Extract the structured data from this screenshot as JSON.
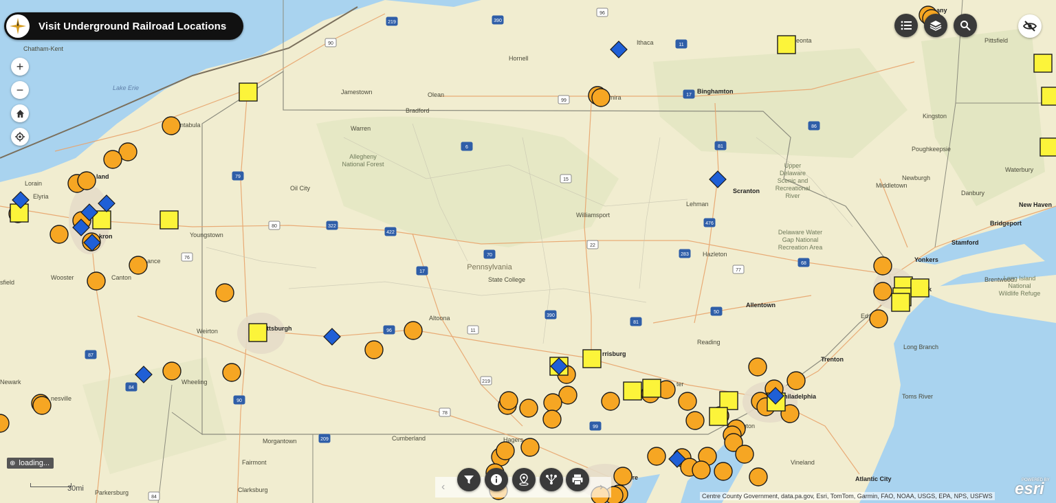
{
  "app": {
    "title": "Visit Underground Railroad Locations"
  },
  "colors": {
    "orange": "#f6a623",
    "yellow": "#fcf43a",
    "blue": "#1f5fd6",
    "dark": "#111111"
  },
  "labels": {
    "regions": [
      "Pennsylvania",
      "Allegheny",
      "National Forest",
      "Upper",
      "Delaware",
      "Scenic and",
      "Recreational",
      "River",
      "Delaware Water",
      "Gap National",
      "Recreation Area",
      "Long Island",
      "National",
      "Wildlife Refuge"
    ],
    "cities": [
      "Chatham-Kent",
      "Lorain",
      "Elyria",
      "land",
      "kron",
      "Canton",
      "Wooster",
      "sfield",
      "ntabula",
      "Youngstown",
      "ance",
      "Oil City",
      "Warren",
      "Bradford",
      "Jamestown",
      "Olean",
      "Hornell",
      "Ithaca",
      "mira",
      "Binghamton",
      "eonta",
      "Williamsport",
      "State College",
      "Altoona",
      "ttsburgh",
      "Weirton",
      "Wheeling",
      "nesville",
      "Newark",
      "Morgantown",
      "Fairmont",
      "Clarksburg",
      "Parkersburg",
      "Cumberland",
      "Hagers",
      "rrisburg",
      "Reading",
      "ter",
      "Allentown",
      "Scranton",
      "Lehman",
      "Hazleton",
      "hiladelphia",
      "Trenton",
      "Vineland",
      "Atlantic City",
      "Toms River",
      "Long Branch",
      "mington",
      "ltimore",
      "Yonkers",
      "Stamford",
      "Bridgeport",
      "New Haven",
      "Waterbury",
      "Danbury",
      "Middletown",
      "Newburgh",
      "Poughkeepsie",
      "Kingston",
      "Pittsfield",
      "any",
      "Brentwood",
      "Ed",
      "k"
    ],
    "water": [
      "Lake Erie"
    ],
    "shields": [
      "90",
      "219",
      "390",
      "96",
      "11",
      "17",
      "99",
      "86",
      "6",
      "15",
      "81",
      "476",
      "80",
      "79",
      "322",
      "76",
      "422",
      "70",
      "22",
      "283",
      "68",
      "77",
      "50",
      "81",
      "78",
      "209",
      "87",
      "84",
      "84"
    ]
  },
  "ui": {
    "zoom_in": "+",
    "zoom_out": "−",
    "loading": "loading...",
    "scale": "30mi",
    "attribution": "Centre County Government, data.pa.gov, Esri, TomTom, Garmin, FAO, NOAA, USGS, EPA, NPS, USFWS",
    "esri": "esri",
    "powered": "POWERED BY"
  },
  "markers": {
    "orange_count_hint": "circles",
    "yellow_count_hint": "squares",
    "blue_count_hint": "diamonds"
  }
}
